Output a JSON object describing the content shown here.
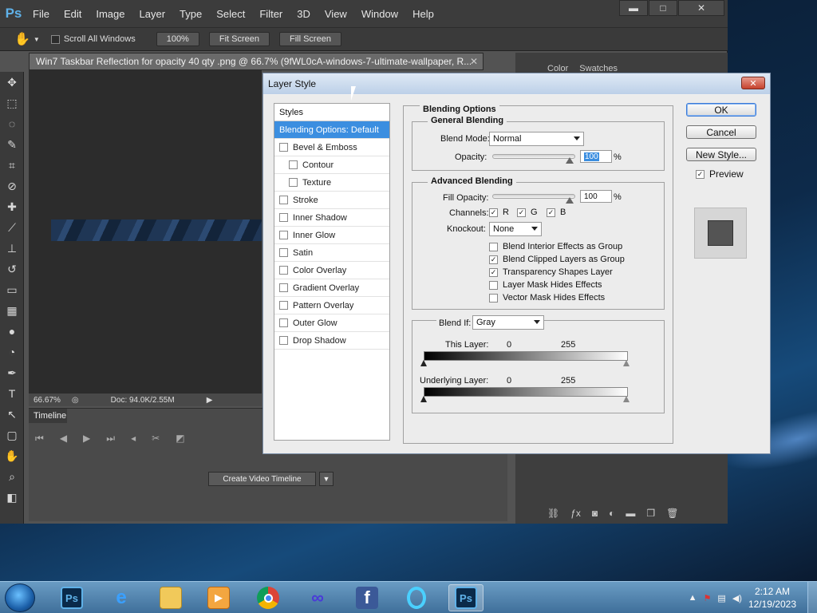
{
  "menubar": {
    "logo": "Ps",
    "items": [
      "File",
      "Edit",
      "Image",
      "Layer",
      "Type",
      "Select",
      "Filter",
      "3D",
      "View",
      "Window",
      "Help"
    ]
  },
  "optionsbar": {
    "scroll_all": "Scroll All Windows",
    "zoom_btn": "100%",
    "fit_screen": "Fit Screen",
    "fill_screen": "Fill Screen"
  },
  "document": {
    "tab_title": "Win7 Taskbar Reflection for opacity 40 qty .png @ 66.7% (9fWL0cA-windows-7-ultimate-wallpaper, R...",
    "zoom": "66.67%",
    "doc_size": "Doc: 94.0K/2.55M"
  },
  "timeline": {
    "title": "Timeline",
    "create_btn": "Create Video Timeline"
  },
  "right_panel": {
    "tabs": [
      "Color",
      "Swatches"
    ]
  },
  "dialog": {
    "title": "Layer Style",
    "styles_header": "Styles",
    "style_items": [
      {
        "label": "Blending Options: Default",
        "checkbox": false,
        "checked": false,
        "sub": false,
        "active": true
      },
      {
        "label": "Bevel & Emboss",
        "checkbox": true,
        "checked": false,
        "sub": false,
        "active": false
      },
      {
        "label": "Contour",
        "checkbox": true,
        "checked": false,
        "sub": true,
        "active": false
      },
      {
        "label": "Texture",
        "checkbox": true,
        "checked": false,
        "sub": true,
        "active": false
      },
      {
        "label": "Stroke",
        "checkbox": true,
        "checked": false,
        "sub": false,
        "active": false
      },
      {
        "label": "Inner Shadow",
        "checkbox": true,
        "checked": false,
        "sub": false,
        "active": false
      },
      {
        "label": "Inner Glow",
        "checkbox": true,
        "checked": false,
        "sub": false,
        "active": false
      },
      {
        "label": "Satin",
        "checkbox": true,
        "checked": false,
        "sub": false,
        "active": false
      },
      {
        "label": "Color Overlay",
        "checkbox": true,
        "checked": false,
        "sub": false,
        "active": false
      },
      {
        "label": "Gradient Overlay",
        "checkbox": true,
        "checked": false,
        "sub": false,
        "active": false
      },
      {
        "label": "Pattern Overlay",
        "checkbox": true,
        "checked": false,
        "sub": false,
        "active": false
      },
      {
        "label": "Outer Glow",
        "checkbox": true,
        "checked": false,
        "sub": false,
        "active": false
      },
      {
        "label": "Drop Shadow",
        "checkbox": true,
        "checked": false,
        "sub": false,
        "active": false
      }
    ],
    "blending_options_title": "Blending Options",
    "general_blending_title": "General Blending",
    "blend_mode_label": "Blend Mode:",
    "blend_mode_value": "Normal",
    "opacity_label": "Opacity:",
    "opacity_value": "100",
    "percent": "%",
    "advanced_blending_title": "Advanced Blending",
    "fill_opacity_label": "Fill Opacity:",
    "fill_opacity_value": "100",
    "channels_label": "Channels:",
    "channels": [
      "R",
      "G",
      "B"
    ],
    "knockout_label": "Knockout:",
    "knockout_value": "None",
    "adv_checks": [
      {
        "label": "Blend Interior Effects as Group",
        "checked": false
      },
      {
        "label": "Blend Clipped Layers as Group",
        "checked": true
      },
      {
        "label": "Transparency Shapes Layer",
        "checked": true
      },
      {
        "label": "Layer Mask Hides Effects",
        "checked": false
      },
      {
        "label": "Vector Mask Hides Effects",
        "checked": false
      }
    ],
    "blend_if_label": "Blend If:",
    "blend_if_value": "Gray",
    "this_layer_label": "This Layer:",
    "underlying_layer_label": "Underlying Layer:",
    "range_min": "0",
    "range_max": "255",
    "ok": "OK",
    "cancel": "Cancel",
    "new_style": "New Style...",
    "preview": "Preview"
  },
  "taskbar": {
    "time": "2:12 AM",
    "date": "12/19/2023"
  }
}
